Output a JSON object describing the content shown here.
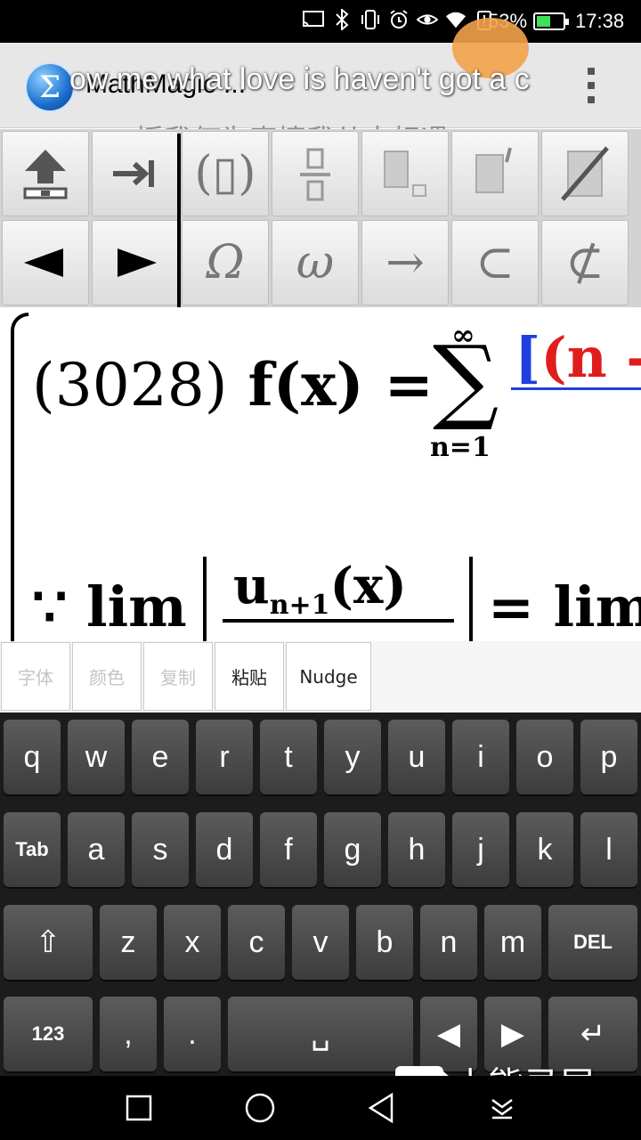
{
  "status_bar": {
    "battery_percent": "53%",
    "battery_level": 0.53,
    "time": "17:38",
    "icons": [
      "screencast-icon",
      "bluetooth-icon",
      "vibrate-icon",
      "alarm-icon",
      "eye-icon",
      "wifi-icon",
      "battery-alert-icon"
    ]
  },
  "action_bar": {
    "app_title": "MathMagic  ...",
    "app_icon_glyph": "Σ",
    "lyric_line_1": "ow me what love is haven't got a c",
    "lyric_line_2": "授我何为真情我从未相遇"
  },
  "toolbar": {
    "row1": [
      {
        "name": "shift-up-button",
        "glyph": "⇧"
      },
      {
        "name": "tab-button",
        "glyph": "⇥"
      },
      {
        "name": "parentheses-button",
        "glyph": "(▯)"
      },
      {
        "name": "fraction-button",
        "glyph": "▭"
      },
      {
        "name": "subscript-button",
        "glyph": "▪"
      },
      {
        "name": "prime-button",
        "glyph": "▪′"
      },
      {
        "name": "strike-button",
        "glyph": "⧄"
      }
    ],
    "row2": [
      {
        "name": "left-arrow-button",
        "glyph": "◀"
      },
      {
        "name": "right-arrow-button",
        "glyph": "▶"
      },
      {
        "name": "omega-upper-button",
        "glyph": "Ω"
      },
      {
        "name": "omega-lower-button",
        "glyph": "ω"
      },
      {
        "name": "arrow-right-symbol-button",
        "glyph": "→"
      },
      {
        "name": "subset-button",
        "glyph": "⊂"
      },
      {
        "name": "not-subset-button",
        "glyph": "⊄"
      }
    ]
  },
  "math": {
    "eq1_left": "(3028)",
    "eq1_func": "f(x) =",
    "sigma": "∑",
    "sigma_top": "∞",
    "sigma_bottom": "n=1",
    "frac_bracket": "[",
    "frac_paren": "(n -",
    "eq2_prefix": "∵ lim",
    "eq2_num": "u",
    "eq2_num_sub": "n+1",
    "eq2_num_arg": "(x)",
    "eq2_right": "= lim"
  },
  "edit_menu": [
    {
      "label": "字体",
      "enabled": false
    },
    {
      "label": "颜色",
      "enabled": false
    },
    {
      "label": "复制",
      "enabled": false
    },
    {
      "label": "粘贴",
      "enabled": true
    },
    {
      "label": "Nudge",
      "enabled": true
    }
  ],
  "keyboard": {
    "row1": [
      "q",
      "w",
      "e",
      "r",
      "t",
      "y",
      "u",
      "i",
      "o",
      "p"
    ],
    "row2": [
      "Tab",
      "a",
      "s",
      "d",
      "f",
      "g",
      "h",
      "j",
      "k",
      "l"
    ],
    "row3": [
      "⇧",
      "z",
      "x",
      "c",
      "v",
      "b",
      "n",
      "m",
      "DEL"
    ],
    "row4": [
      "123",
      ",",
      ".",
      "␣",
      "◀",
      "▶",
      "↵"
    ]
  },
  "watermark": "小熊录屏",
  "nav": [
    "recents-square-icon",
    "home-circle-icon",
    "back-triangle-icon",
    "notification-down-icon"
  ]
}
